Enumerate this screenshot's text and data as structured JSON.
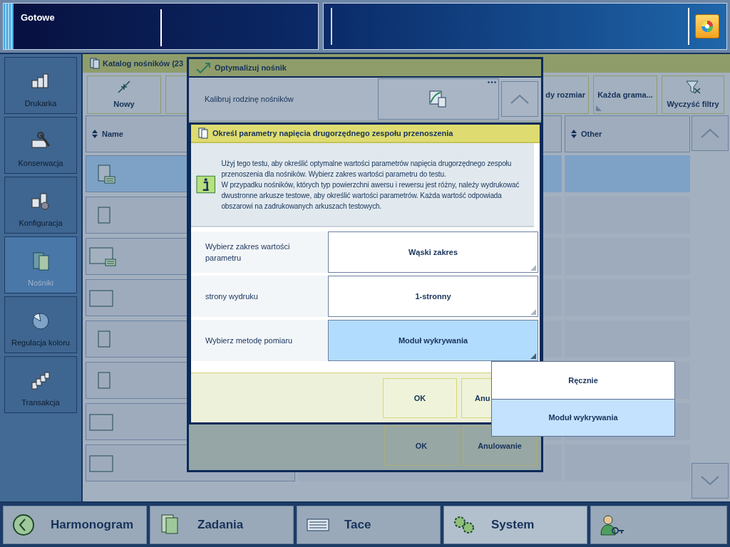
{
  "status": {
    "text": "Gotowe"
  },
  "sidebar": {
    "items": [
      {
        "label": "Drukarka",
        "kind": "printer",
        "selected": false
      },
      {
        "label": "Konserwacja",
        "kind": "tools",
        "selected": false
      },
      {
        "label": "Konfiguracja",
        "kind": "config",
        "selected": false
      },
      {
        "label": "Nośniki",
        "kind": "media",
        "selected": true
      },
      {
        "label": "Regulacja koloru",
        "kind": "color",
        "selected": false
      },
      {
        "label": "Transakcja",
        "kind": "stack",
        "selected": false
      }
    ]
  },
  "catalog": {
    "title": "Katalog nośników (23",
    "toolbar": [
      {
        "label": "Nowy",
        "kind": "new"
      },
      {
        "label": "dy rozmiar",
        "kind": "plain"
      },
      {
        "label": "Każda grama...",
        "kind": "dropdown"
      },
      {
        "label": "Wyczyść filtry",
        "kind": "clear"
      }
    ],
    "columns": [
      "Name",
      "Other"
    ],
    "rows": [
      {
        "kind": "sheet-note",
        "selected": true
      },
      {
        "kind": "sheet",
        "selected": false
      },
      {
        "kind": "wide-note",
        "selected": false
      },
      {
        "kind": "wide",
        "selected": false
      },
      {
        "kind": "sheet",
        "selected": false
      },
      {
        "kind": "sheet",
        "selected": false
      },
      {
        "kind": "wide",
        "selected": false
      },
      {
        "kind": "wide",
        "selected": false
      }
    ]
  },
  "dialog": {
    "title": "Optymalizuj nośnik",
    "row_label": "Kalibruj rodzinę nośników",
    "buttons": [
      "OK",
      "Anulowanie"
    ]
  },
  "subdialog": {
    "title": "Określ parametry napięcia drugorzędnego zespołu przenoszenia",
    "info": "Użyj tego testu, aby określić optymalne wartości parametrów napięcia drugorzędnego zespołu przenoszenia dla nośników. Wybierz zakres wartości parametru do testu.\nW przypadku nośników, których typ powierzchni awersu i rewersu jest różny, należy wydrukować dwustronne arkusze testowe, aby określić wartości parametrów. Każda wartość odpowiada obszarowi na zadrukowanych arkuszach testowych.",
    "fields": [
      {
        "label": "Wybierz zakres wartości parametru",
        "value": "Wąski zakres",
        "selected": false
      },
      {
        "label": "strony wydruku",
        "value": "1-stronny",
        "selected": false
      },
      {
        "label": "Wybierz metodę pomiaru",
        "value": "Moduł wykrywania",
        "selected": true
      }
    ],
    "buttons": [
      "OK",
      "Anu"
    ]
  },
  "dropdown": {
    "options": [
      {
        "label": "Ręcznie",
        "selected": false
      },
      {
        "label": "Moduł wykrywania",
        "selected": true
      }
    ]
  },
  "nav": [
    {
      "label": "Harmonogram",
      "kind": "clock",
      "selected": false
    },
    {
      "label": "Zadania",
      "kind": "jobs",
      "selected": false
    },
    {
      "label": "Tace",
      "kind": "trays",
      "selected": false
    },
    {
      "label": "System",
      "kind": "gears",
      "selected": true
    },
    {
      "kind": "user",
      "selected": false
    }
  ]
}
